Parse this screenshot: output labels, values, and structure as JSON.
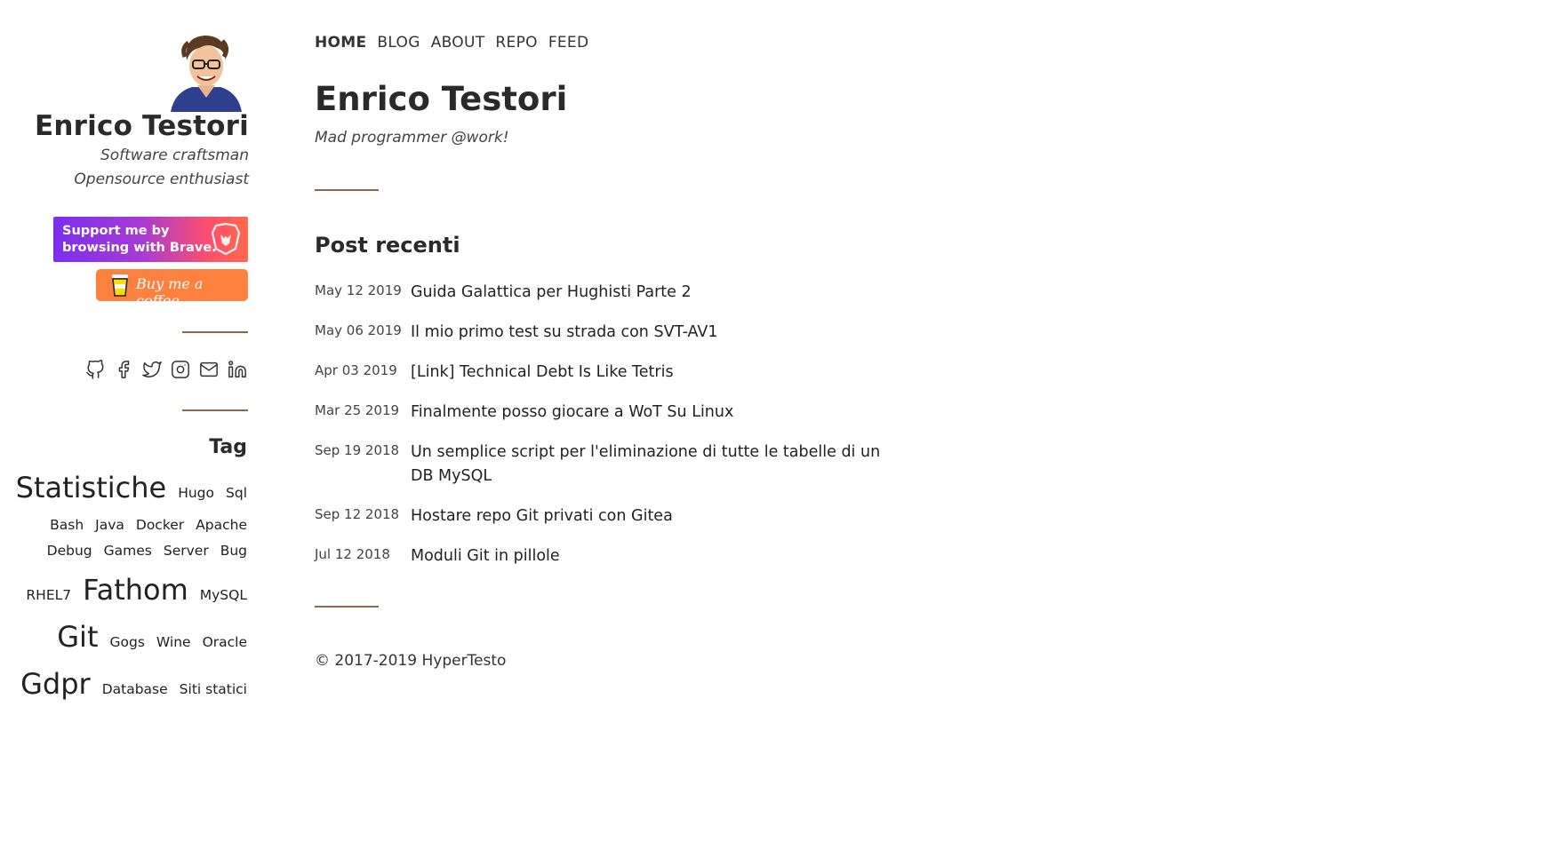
{
  "sidebar": {
    "author_name": "Enrico Testori",
    "taglines": [
      "Software craftsman",
      "Opensource enthusiast"
    ],
    "brave_badge": [
      "Support me by",
      "browsing with Brave."
    ],
    "coffee_badge": "Buy me a coffee",
    "social_icons": [
      "github-icon",
      "facebook-icon",
      "twitter-icon",
      "instagram-icon",
      "email-icon",
      "linkedin-icon"
    ],
    "tag_heading": "Tag",
    "tags": {
      "row1": [
        "Statistiche",
        "Hugo",
        "Sql"
      ],
      "row2": [
        "Bash",
        "Java",
        "Docker",
        "Apache"
      ],
      "row3": [
        "Debug",
        "Games",
        "Server",
        "Bug"
      ],
      "row4": [
        "RHEL7",
        "Fathom",
        "MySQL"
      ],
      "row5": [
        "Git",
        "Gogs",
        "Wine",
        "Oracle"
      ],
      "row6": [
        "Gdpr",
        "Database",
        "Siti statici"
      ]
    }
  },
  "nav": [
    "HOME",
    "BLOG",
    "ABOUT",
    "REPO",
    "FEED"
  ],
  "main": {
    "title": "Enrico Testori",
    "subtitle": "Mad programmer @work!",
    "recent_heading": "Post recenti",
    "posts": [
      {
        "date": "May 12 2019",
        "title": "Guida Galattica per Hughisti Parte 2"
      },
      {
        "date": "May 06 2019",
        "title": "Il mio primo test su strada con SVT-AV1"
      },
      {
        "date": "Apr 03 2019",
        "title": "[Link] Technical Debt Is Like Tetris"
      },
      {
        "date": "Mar 25 2019",
        "title": "Finalmente posso giocare a WoT Su Linux"
      },
      {
        "date": "Sep 19 2018",
        "title": "Un semplice script per l'eliminazione di tutte le tabelle di un DB MySQL"
      },
      {
        "date": "Sep 12 2018",
        "title": "Hostare repo Git privati con Gitea"
      },
      {
        "date": "Jul 12 2018",
        "title": "Moduli Git in pillole"
      }
    ]
  },
  "footer": "© 2017-2019 HyperTesto",
  "colors": {
    "rule": "#8b6a4d",
    "coffee": "#ff813f",
    "brave_start": "#7b2ff0",
    "brave_end": "#ff6a4d"
  }
}
